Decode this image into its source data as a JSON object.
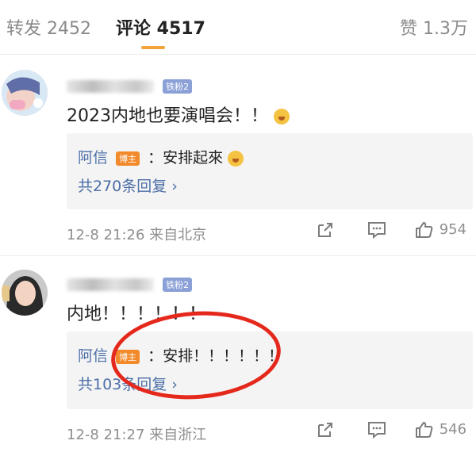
{
  "tabs": {
    "reposts": "转发 2452",
    "comments": "评论 4517",
    "likes": "赞 1.3万"
  },
  "comments": [
    {
      "fan_badge": "铁粉2",
      "text": "2023内地也要演唱会！！",
      "reply": {
        "author": "阿信",
        "badge": "博主",
        "text": "：安排起來",
        "count": "共270条回复 ›"
      },
      "meta": "12-8 21:26  来自北京",
      "likes": "954"
    },
    {
      "fan_badge": "铁粉2",
      "text": "内地！！！！！！",
      "reply": {
        "author": "阿信",
        "badge": "博主",
        "text": "：安排！！！！！！",
        "count": "共103条回复 ›"
      },
      "meta": "12-8 21:27  来自浙江",
      "likes": "546"
    }
  ],
  "icons": [
    "thumb-up-icon",
    "comment-icon",
    "share-icon",
    "chevron-right-icon"
  ],
  "colors": {
    "accent": "#f2a33a",
    "link": "#4d6fa8",
    "highlight_circle": "#e5281c"
  }
}
